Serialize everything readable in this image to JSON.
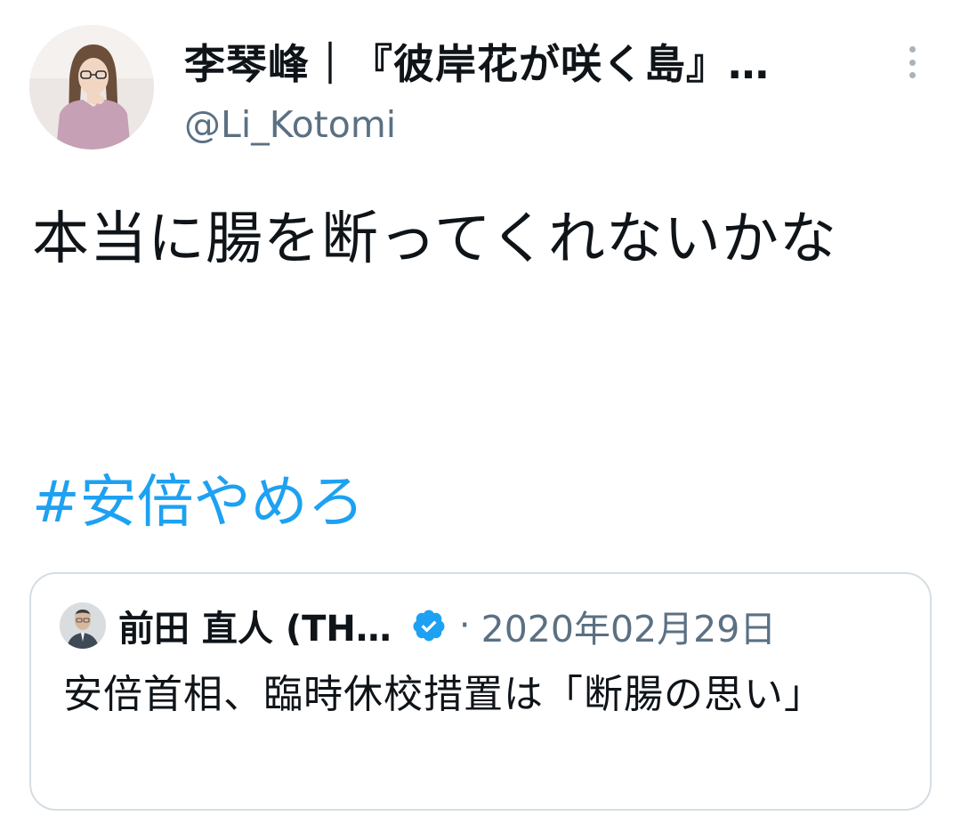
{
  "author": {
    "display_name": "李琴峰｜『彼岸花が咲く島』…",
    "handle": "@Li_Kotomi"
  },
  "tweet": {
    "text": "本当に腸を断ってくれないかな",
    "hashtag": "#安倍やめろ"
  },
  "quoted_tweet": {
    "author_name": "前田 直人 (TH…",
    "separator": "·",
    "date": "2020年02月29日",
    "text": "安倍首相、臨時休校措置は「断腸の思い」"
  },
  "icons": {
    "more": "more-vertical-icon",
    "verified": "verified-badge-icon"
  },
  "colors": {
    "link": "#1da1f2",
    "secondary_text": "#5b7083",
    "card_border": "#d5dde3",
    "verified": "#1da1f2"
  }
}
